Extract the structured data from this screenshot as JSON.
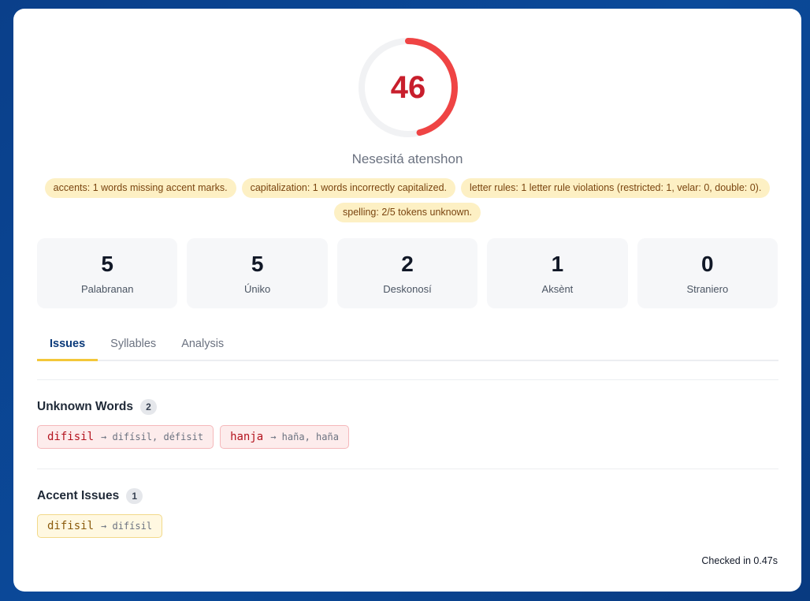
{
  "score": {
    "value": "46",
    "fraction": 0.46,
    "color": "#ef4444",
    "track_color": "#f1f2f4",
    "status": "Nesesitá atenshon"
  },
  "issue_pills": [
    "accents: 1 words missing accent marks.",
    "capitalization: 1 words incorrectly capitalized.",
    "letter rules: 1 letter rule violations (restricted: 1, velar: 0, double: 0).",
    "spelling: 2/5 tokens unknown."
  ],
  "stats": [
    {
      "value": "5",
      "label": "Palabranan"
    },
    {
      "value": "5",
      "label": "Úniko"
    },
    {
      "value": "2",
      "label": "Deskonosí"
    },
    {
      "value": "1",
      "label": "Aksènt"
    },
    {
      "value": "0",
      "label": "Straniero"
    }
  ],
  "tabs": [
    {
      "label": "Issues",
      "active": true
    },
    {
      "label": "Syllables",
      "active": false
    },
    {
      "label": "Analysis",
      "active": false
    }
  ],
  "unknown_words": {
    "title": "Unknown Words",
    "count": "2",
    "items": [
      {
        "word": "difisil",
        "suggestions": "→ difísil, défisit"
      },
      {
        "word": "hanja",
        "suggestions": "→ haña, haña"
      }
    ]
  },
  "accent_issues": {
    "title": "Accent Issues",
    "count": "1",
    "items": [
      {
        "word": "difisil",
        "suggestions": "→ difísil"
      }
    ]
  },
  "footer": {
    "checked": "Checked in 0.47s"
  }
}
